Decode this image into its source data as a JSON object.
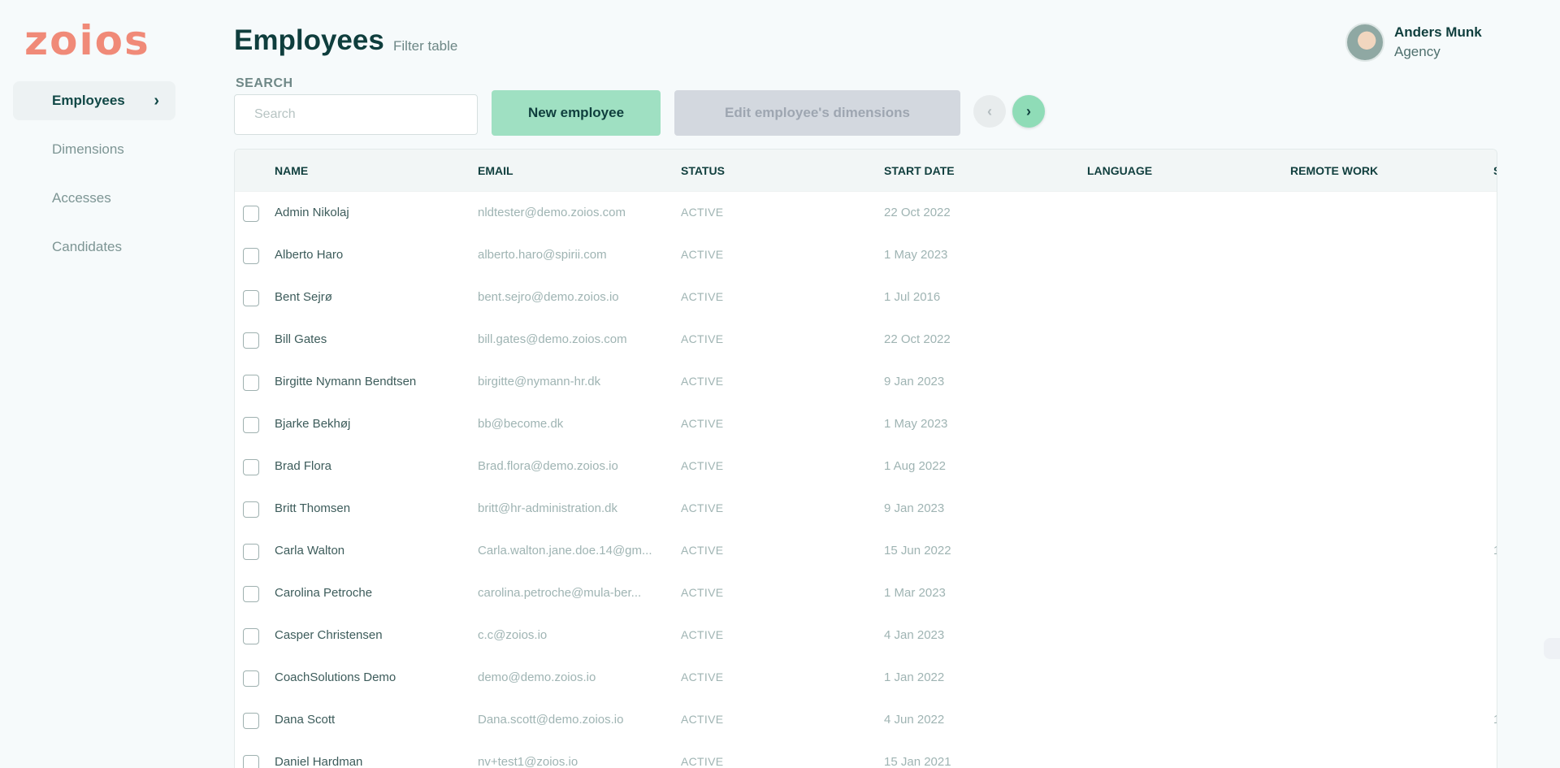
{
  "brand": {
    "logo_text": "zoios",
    "logo_color": "#f08a78"
  },
  "sidebar": {
    "items": [
      {
        "label": "Employees",
        "active": true
      },
      {
        "label": "Dimensions",
        "active": false
      },
      {
        "label": "Accesses",
        "active": false
      },
      {
        "label": "Candidates",
        "active": false
      }
    ],
    "active_chevron": "›"
  },
  "header": {
    "title": "Employees",
    "filter_link": "Filter table"
  },
  "user": {
    "name": "Anders Munk",
    "role": "Agency"
  },
  "search": {
    "label": "SEARCH",
    "placeholder": "Search",
    "value": ""
  },
  "toolbar": {
    "new_label": "New employee",
    "edit_label": "Edit employee's dimensions",
    "prev_icon": "‹",
    "next_icon": "›",
    "new_color": "#9fe0c2",
    "edit_color": "#d3d8df"
  },
  "table": {
    "columns": [
      "NAME",
      "EMAIL",
      "STATUS",
      "START DATE",
      "LANGUAGE",
      "REMOTE WORK",
      "S"
    ],
    "rows": [
      {
        "name": "Admin Nikolaj",
        "email": "nldtester@demo.zoios.com",
        "status": "ACTIVE",
        "start": "22 Oct 2022",
        "extra": ""
      },
      {
        "name": "Alberto Haro",
        "email": "alberto.haro@spirii.com",
        "status": "ACTIVE",
        "start": "1 May 2023",
        "extra": ""
      },
      {
        "name": "Bent Sejrø",
        "email": "bent.sejro@demo.zoios.io",
        "status": "ACTIVE",
        "start": "1 Jul 2016",
        "extra": ""
      },
      {
        "name": "Bill Gates",
        "email": "bill.gates@demo.zoios.com",
        "status": "ACTIVE",
        "start": "22 Oct 2022",
        "extra": ""
      },
      {
        "name": "Birgitte Nymann Bendtsen",
        "email": "birgitte@nymann-hr.dk",
        "status": "ACTIVE",
        "start": "9 Jan 2023",
        "extra": ""
      },
      {
        "name": "Bjarke Bekhøj",
        "email": "bb@become.dk",
        "status": "ACTIVE",
        "start": "1 May 2023",
        "extra": ""
      },
      {
        "name": "Brad Flora",
        "email": "Brad.flora@demo.zoios.io",
        "status": "ACTIVE",
        "start": "1 Aug 2022",
        "extra": ""
      },
      {
        "name": "Britt Thomsen",
        "email": "britt@hr-administration.dk",
        "status": "ACTIVE",
        "start": "9 Jan 2023",
        "extra": ""
      },
      {
        "name": "Carla Walton",
        "email": "Carla.walton.jane.doe.14@gm...",
        "status": "ACTIVE",
        "start": "15 Jun 2022",
        "extra": "1"
      },
      {
        "name": "Carolina Petroche",
        "email": "carolina.petroche@mula-ber...",
        "status": "ACTIVE",
        "start": "1 Mar 2023",
        "extra": ""
      },
      {
        "name": "Casper Christensen",
        "email": "c.c@zoios.io",
        "status": "ACTIVE",
        "start": "4 Jan 2023",
        "extra": ""
      },
      {
        "name": "CoachSolutions Demo",
        "email": "demo@demo.zoios.io",
        "status": "ACTIVE",
        "start": "1 Jan 2022",
        "extra": ""
      },
      {
        "name": "Dana Scott",
        "email": "Dana.scott@demo.zoios.io",
        "status": "ACTIVE",
        "start": "4 Jun 2022",
        "extra": "1"
      },
      {
        "name": "Daniel Hardman",
        "email": "nv+test1@zoios.io",
        "status": "ACTIVE",
        "start": "15 Jan 2021",
        "extra": ""
      }
    ]
  }
}
